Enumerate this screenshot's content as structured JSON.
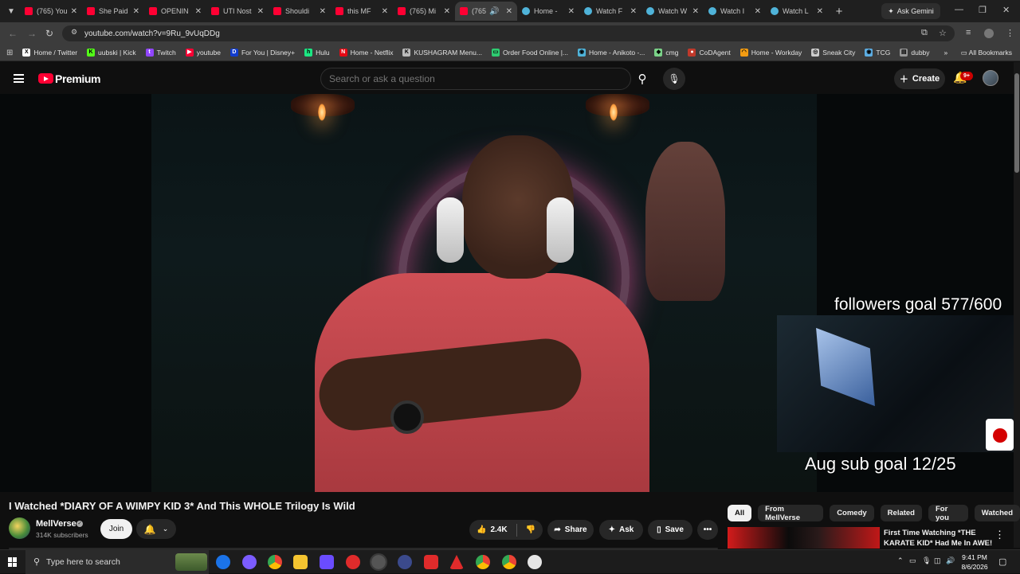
{
  "browser": {
    "tabs": [
      {
        "label": "(765) You",
        "icon": "youtube-icon"
      },
      {
        "label": "She Paid",
        "icon": "youtube-icon"
      },
      {
        "label": "OPENIN",
        "icon": "youtube-icon"
      },
      {
        "label": "UTI Nost",
        "icon": "youtube-icon"
      },
      {
        "label": "Shouldi",
        "icon": "youtube-icon"
      },
      {
        "label": "this MF",
        "icon": "youtube-icon"
      },
      {
        "label": "(765) Mi",
        "icon": "youtube-icon"
      },
      {
        "label": "(765)",
        "icon": "youtube-icon",
        "active": true
      },
      {
        "label": "Home -",
        "icon": "globe-icon"
      },
      {
        "label": "Watch F",
        "icon": "globe-icon"
      },
      {
        "label": "Watch W",
        "icon": "globe-icon"
      },
      {
        "label": "Watch I",
        "icon": "globe-icon"
      },
      {
        "label": "Watch L",
        "icon": "globe-icon"
      }
    ],
    "ask_gemini": "Ask Gemini",
    "url": "youtube.com/watch?v=9Ru_9vUqDDg",
    "bookmarks": [
      {
        "label": "Home / Twitter",
        "color": "#ffffff",
        "glyph": "X"
      },
      {
        "label": "uubski | Kick",
        "color": "#53fc18",
        "glyph": "K"
      },
      {
        "label": "Twitch",
        "color": "#9146ff",
        "glyph": "t"
      },
      {
        "label": "youtube",
        "color": "#ff0033",
        "glyph": "▶"
      },
      {
        "label": "For You | Disney+",
        "color": "#113ccf",
        "glyph": "D"
      },
      {
        "label": "Hulu",
        "color": "#1ce783",
        "glyph": "h"
      },
      {
        "label": "Home - Netflix",
        "color": "#e50914",
        "glyph": "N"
      },
      {
        "label": "KUSHAGRAM Menu...",
        "color": "#bbbbbb",
        "glyph": "K"
      },
      {
        "label": "Order Food Online |...",
        "color": "#2ecc71",
        "glyph": "▭"
      },
      {
        "label": "Home - Anikoto -...",
        "color": "#4fb3d9",
        "glyph": "◉"
      },
      {
        "label": "cmg",
        "color": "#7bd389",
        "glyph": "◆"
      },
      {
        "label": "CoDAgent",
        "color": "#c0392b",
        "glyph": "●"
      },
      {
        "label": "Home - Workday",
        "color": "#f39c12",
        "glyph": "◠"
      },
      {
        "label": "Sneak City",
        "color": "#cccccc",
        "glyph": "◎"
      },
      {
        "label": "TCG",
        "color": "#5dade2",
        "glyph": "◉"
      },
      {
        "label": "dubby",
        "color": "#999999",
        "glyph": "▤"
      }
    ],
    "all_bookmarks": "All Bookmarks"
  },
  "youtube": {
    "brand": "Premium",
    "search_placeholder": "Search or ask a question",
    "create_label": "Create",
    "notifications_badge": "9+",
    "overlay_followers": "followers goal 577/600",
    "overlay_subs": "Aug sub goal 12/25",
    "video_title": "I Watched *DIARY OF A WIMPY KID 3* And This WHOLE Trilogy Is Wild",
    "channel_name": "MellVerse",
    "subscribers": "314K subscribers",
    "join_label": "Join",
    "likes": "2.4K",
    "share_label": "Share",
    "ask_label": "Ask",
    "save_label": "Save",
    "chips": [
      "All",
      "From MellVerse",
      "Comedy",
      "Related",
      "For you",
      "Watched"
    ],
    "recommendation_title": "First Time Watching *THE KARATE KID* Had Me In AWE!"
  },
  "taskbar": {
    "search_placeholder": "Type here to search",
    "time": "9:41 PM",
    "date": "8/6/2026"
  }
}
